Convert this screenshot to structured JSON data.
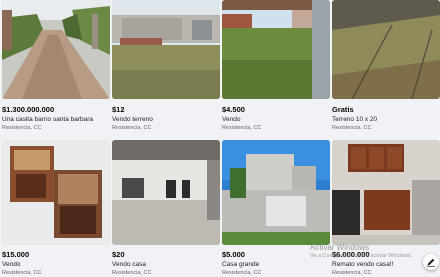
{
  "listings": [
    {
      "price": "$1.300.000.000",
      "title": "Una casita barrio santa barbara",
      "location": "Resistencia, CC",
      "image": "dirt-road-photo"
    },
    {
      "price": "$12",
      "title": "Vendo terreno",
      "location": "Resistencia, CC",
      "image": "vacant-lot-photo"
    },
    {
      "price": "$4.500",
      "title": "Vendo",
      "location": "Resistencia, CC",
      "image": "grass-lot-photo"
    },
    {
      "price": "Gratis",
      "title": "Terreno 10 x 20",
      "location": "Resistencia, CC",
      "image": "sloped-lot-photo"
    },
    {
      "price": "$15.000",
      "title": "Vendo",
      "location": "Resistencia, CC",
      "image": "interior-collage-photo"
    },
    {
      "price": "$20",
      "title": "Vendo casa",
      "location": "Resistencia, CC",
      "image": "house-interior-photo"
    },
    {
      "price": "$5.000",
      "title": "Casa grande",
      "location": "Resistencia, CC",
      "image": "house-exterior-photo"
    },
    {
      "price": "$6.000.000",
      "title": "Remato vendo casa!!",
      "location": "Resistencia, CC",
      "image": "kitchen-photo"
    }
  ],
  "watermark": {
    "line1": "Activar Windows",
    "line2": "Ve a Configuración para activar Windows."
  },
  "fab_icon": "compose-icon"
}
